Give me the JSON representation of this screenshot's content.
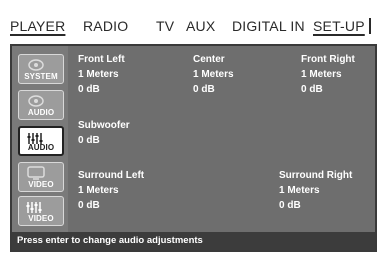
{
  "menu": {
    "items": [
      {
        "label": "PLAYER"
      },
      {
        "label": "RADIO"
      },
      {
        "label": "TV"
      },
      {
        "label": "AUX"
      },
      {
        "label": "DIGITAL IN"
      },
      {
        "label": "SET-UP"
      }
    ],
    "selected": "SET-UP"
  },
  "sidebar": {
    "buttons": [
      {
        "label": "SYSTEM",
        "icon": "speaker-icon"
      },
      {
        "label": "AUDIO",
        "icon": "speaker-icon"
      },
      {
        "label": "AUDIO",
        "icon": "equalizer-icon",
        "selected": true
      },
      {
        "label": "VIDEO",
        "icon": "screen-icon"
      },
      {
        "label": "VIDEO",
        "icon": "equalizer-icon"
      }
    ]
  },
  "speakers": {
    "front_left": {
      "name": "Front Left",
      "distance": "1 Meters",
      "level": "0 dB"
    },
    "center": {
      "name": "Center",
      "distance": "1 Meters",
      "level": "0 dB"
    },
    "front_right": {
      "name": "Front Right",
      "distance": "1 Meters",
      "level": "0 dB"
    },
    "subwoofer": {
      "name": "Subwoofer",
      "level": "0 dB"
    },
    "surround_left": {
      "name": "Surround Left",
      "distance": "1 Meters",
      "level": "0 dB"
    },
    "surround_right": {
      "name": "Surround Right",
      "distance": "1 Meters",
      "level": "0 dB"
    }
  },
  "status": {
    "text": "Press enter to change audio adjustments"
  }
}
